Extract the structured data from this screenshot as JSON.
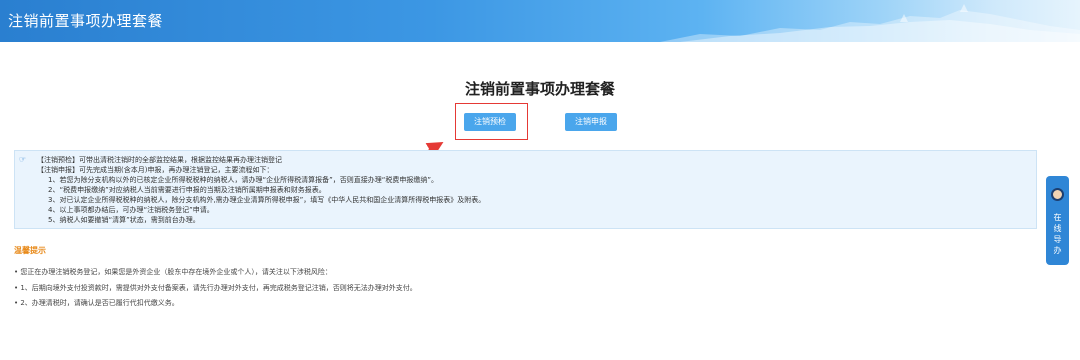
{
  "header": {
    "title": "注销前置事项办理套餐"
  },
  "page": {
    "title": "注销前置事项办理套餐"
  },
  "buttons": {
    "precheck": "注销预检",
    "apply": "注销申报"
  },
  "info": {
    "lines": [
      "【注销预检】可带出清税注销时的全部监控结果，根据监控结果再办理注销登记",
      "【注销申报】可先完成当期(含本月)申报，再办理注销登记，主要流程如下：",
      "1、若您为除分支机构以外的已核定企业所得税税种的纳税人，请办理“企业所得税清算报备”，否则直接办理“税费申报缴纳”。",
      "2、“税费申报缴纳”对应纳税人当前需要进行申报的当期及注销所属期申报表和财务报表。",
      "3、对已认定企业所得税税种的纳税人，除分支机构外,需办理企业清算所得税申报”，填写《中华人民共和国企业清算所得税申报表》及附表。",
      "4、以上事项都办结后，可办理“注销税务登记”申请。",
      "5、纳税人如要撤销“清算”状态，需到前台办理。"
    ]
  },
  "tips": {
    "title": "温馨提示",
    "lines": [
      "• 您正在办理注销税务登记，如果您是外资企业（股东中存在境外企业或个人），请关注以下涉税风险：",
      "• 1、后期向境外支付投资款时，需提供对外支付备案表，请先行办理对外支付，再完成税务登记注销，否则将无法办理对外支付。",
      "• 2、办理清税时，请确认是否已履行代扣代缴义务。"
    ]
  },
  "side_guide": {
    "label": "在线导办"
  },
  "colors": {
    "accent": "#4aa6ec",
    "highlight": "#e53935",
    "tips_title": "#e88a1a"
  }
}
